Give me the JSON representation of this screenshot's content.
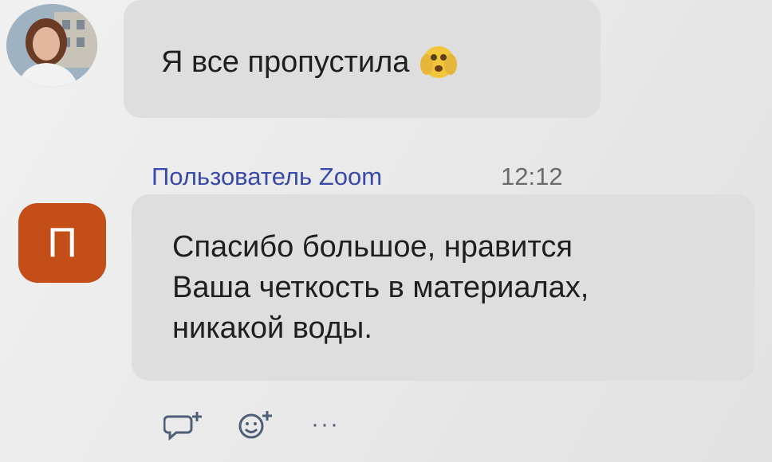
{
  "messages": [
    {
      "text": "Я все пропустила",
      "emoji": "shocked-face-emoji"
    },
    {
      "sender": "Пользователь Zoom",
      "time": "12:12",
      "avatar_initial": "П",
      "avatar_color": "#c34e17",
      "text": "Спасибо большое, нравится\nВаша четкость в материалах,\nникакой воды."
    }
  ],
  "actions": {
    "reply_icon": "comment-plus-icon",
    "reaction_icon": "emoji-plus-icon",
    "more_label": "···"
  },
  "colors": {
    "sender_name": "#3a4aa8",
    "bubble": "#dedede"
  }
}
